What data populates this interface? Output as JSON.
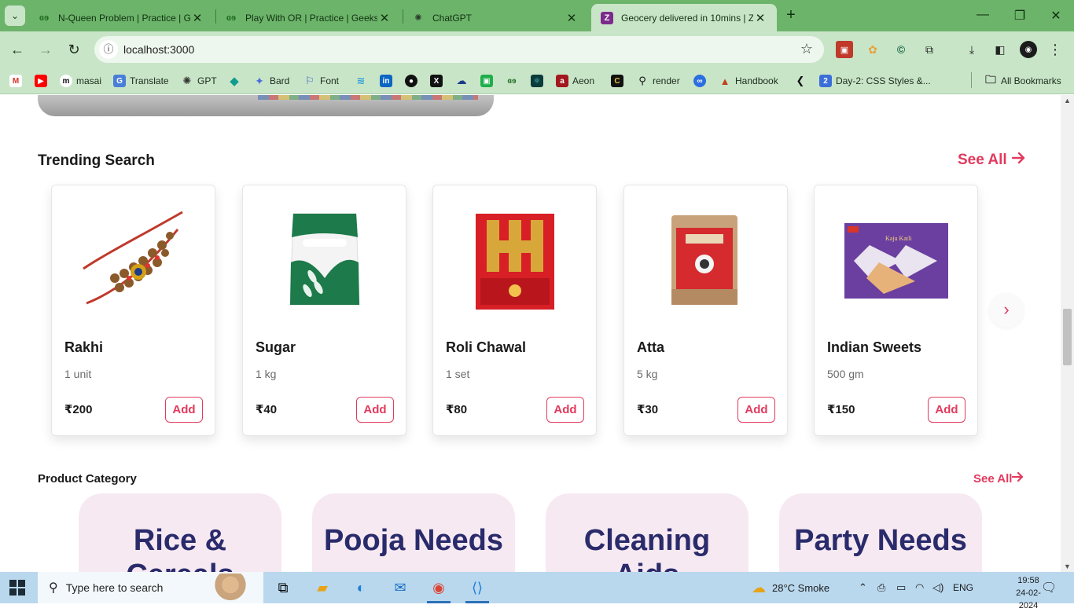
{
  "browser": {
    "tabs": [
      {
        "title": "N-Queen Problem | Practice | G",
        "favicon": "gfg-icon"
      },
      {
        "title": "Play With OR | Practice | Geeksf",
        "favicon": "gfg-icon"
      },
      {
        "title": "ChatGPT",
        "favicon": "chatgpt-icon"
      },
      {
        "title": "Geocery delivered in 10mins | Z",
        "favicon": "z-icon",
        "active": true
      }
    ],
    "url": "localhost:3000",
    "bookmarks": [
      {
        "label": "",
        "icon": "gmail-icon"
      },
      {
        "label": "",
        "icon": "youtube-icon"
      },
      {
        "label": "masai",
        "icon": "masai-icon"
      },
      {
        "label": "Translate",
        "icon": "translate-icon"
      },
      {
        "label": "GPT",
        "icon": "gpt-icon"
      },
      {
        "label": "",
        "icon": "diamond-icon"
      },
      {
        "label": "Bard",
        "icon": "bard-icon"
      },
      {
        "label": "Font",
        "icon": "font-icon"
      },
      {
        "label": "",
        "icon": "wave-icon"
      },
      {
        "label": "",
        "icon": "linkedin-icon"
      },
      {
        "label": "",
        "icon": "github-icon"
      },
      {
        "label": "",
        "icon": "x-icon"
      },
      {
        "label": "",
        "icon": "cloud-icon"
      },
      {
        "label": "",
        "icon": "green-square-icon"
      },
      {
        "label": "",
        "icon": "gfg-icon"
      },
      {
        "label": "",
        "icon": "react-icon"
      },
      {
        "label": "Aeon",
        "icon": "aeon-icon"
      },
      {
        "label": "",
        "icon": "dark-c-icon"
      },
      {
        "label": "render",
        "icon": "render-icon"
      },
      {
        "label": "",
        "icon": "blue-circle-icon"
      },
      {
        "label": "Handbook",
        "icon": "handbook-icon"
      },
      {
        "label": "",
        "icon": "chevron-icon"
      },
      {
        "label": "Day-2: CSS Styles &...",
        "icon": "number-2-icon"
      }
    ],
    "all_bookmarks": "All Bookmarks"
  },
  "page": {
    "trending": {
      "title": "Trending Search",
      "see_all": "See All",
      "add_label": "Add",
      "products": [
        {
          "name": "Rakhi",
          "qty": "1 unit",
          "price": "₹200"
        },
        {
          "name": "Sugar",
          "qty": "1 kg",
          "price": "₹40"
        },
        {
          "name": "Roli Chawal",
          "qty": "1 set",
          "price": "₹80"
        },
        {
          "name": "Atta",
          "qty": "5 kg",
          "price": "₹30"
        },
        {
          "name": "Indian Sweets",
          "qty": "500 gm",
          "price": "₹150"
        }
      ]
    },
    "category": {
      "title": "Product Category",
      "see_all": "See All",
      "items": [
        {
          "line1": "Rice &",
          "line2": "Cereals"
        },
        {
          "line1": "Pooja Needs",
          "line2": ""
        },
        {
          "line1": "Cleaning",
          "line2": "Aids"
        },
        {
          "line1": "Party Needs",
          "line2": ""
        }
      ]
    }
  },
  "taskbar": {
    "search_placeholder": "Type here to search",
    "weather": "28°C  Smoke",
    "lang": "ENG",
    "time": "19:58",
    "date": "24-02-2024"
  },
  "colors": {
    "accent": "#e23a5e",
    "chrome_green": "#6db46b",
    "chrome_light": "#c9e5c8",
    "category_bg": "#f6e9f2",
    "category_text": "#2a2b6b"
  }
}
